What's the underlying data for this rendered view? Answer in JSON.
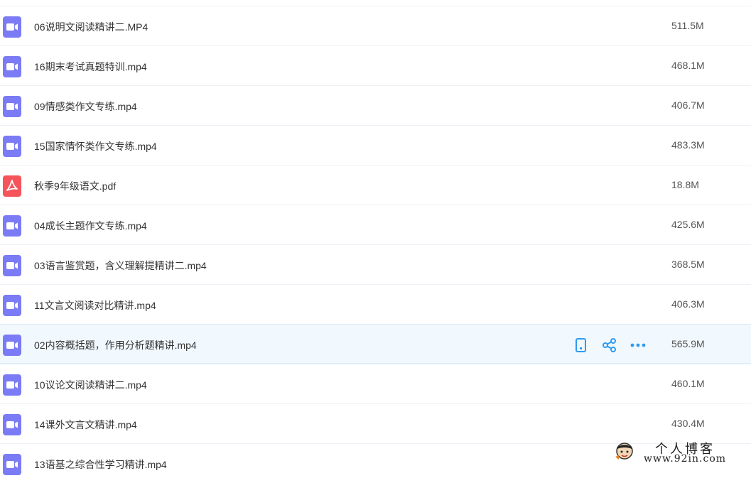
{
  "files": [
    {
      "name": "06说明文阅读精讲二.MP4",
      "size": "511.5M",
      "type": "video"
    },
    {
      "name": "16期末考试真题特训.mp4",
      "size": "468.1M",
      "type": "video"
    },
    {
      "name": "09情感类作文专练.mp4",
      "size": "406.7M",
      "type": "video"
    },
    {
      "name": "15国家情怀类作文专练.mp4",
      "size": "483.3M",
      "type": "video"
    },
    {
      "name": "秋季9年级语文.pdf",
      "size": "18.8M",
      "type": "pdf"
    },
    {
      "name": "04成长主题作文专练.mp4",
      "size": "425.6M",
      "type": "video"
    },
    {
      "name": "03语言鉴赏题，含义理解提精讲二.mp4",
      "size": "368.5M",
      "type": "video"
    },
    {
      "name": "11文言文阅读对比精讲.mp4",
      "size": "406.3M",
      "type": "video"
    },
    {
      "name": "02内容概括题，作用分析题精讲.mp4",
      "size": "565.9M",
      "type": "video",
      "hovered": true
    },
    {
      "name": "10议论文阅读精讲二.mp4",
      "size": "460.1M",
      "type": "video"
    },
    {
      "name": "14课外文言文精讲.mp4",
      "size": "430.4M",
      "type": "video"
    },
    {
      "name": "13语基之综合性学习精讲.mp4",
      "size": "",
      "type": "video"
    }
  ],
  "row_actions": {
    "icons": [
      "phone-icon",
      "share-icon",
      "more-icon"
    ],
    "color": "#2f9bf0"
  },
  "colors": {
    "video_icon": "#7b7bf5",
    "pdf_icon": "#f4545a",
    "hover_row": "#f1f8fe",
    "divider": "#edf1f5"
  },
  "watermark": {
    "title": "个人博客",
    "url": "www.92in.com"
  }
}
